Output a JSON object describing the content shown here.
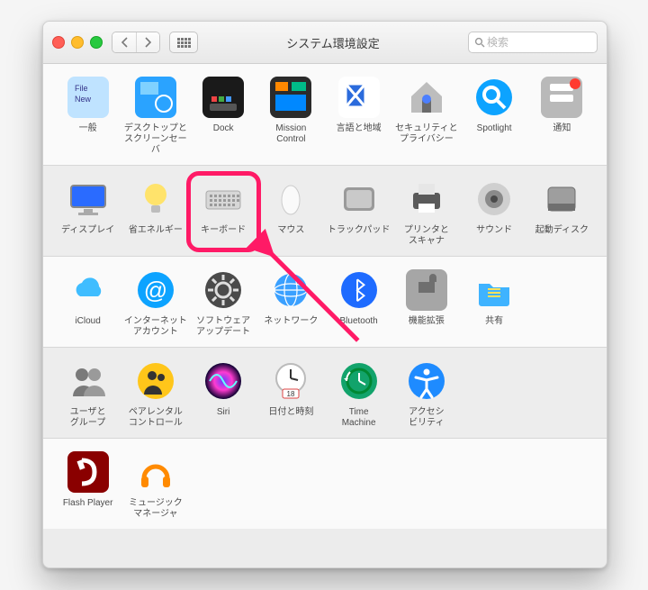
{
  "window_title": "システム環境設定",
  "search_placeholder": "検索",
  "rows": [
    {
      "items": [
        {
          "id": "general",
          "label": "一般",
          "kind": "general"
        },
        {
          "id": "desktop",
          "label": "デスクトップと\nスクリーンセーバ",
          "kind": "desktop"
        },
        {
          "id": "dock",
          "label": "Dock",
          "kind": "dock"
        },
        {
          "id": "mission",
          "label": "Mission\nControl",
          "kind": "mission"
        },
        {
          "id": "lang",
          "label": "言語と地域",
          "kind": "flag"
        },
        {
          "id": "security",
          "label": "セキュリティと\nプライバシー",
          "kind": "house"
        },
        {
          "id": "spotlight",
          "label": "Spotlight",
          "kind": "spotlight"
        },
        {
          "id": "notify",
          "label": "通知",
          "kind": "notify"
        }
      ]
    },
    {
      "items": [
        {
          "id": "display",
          "label": "ディスプレイ",
          "kind": "display"
        },
        {
          "id": "energy",
          "label": "省エネルギー",
          "kind": "bulb"
        },
        {
          "id": "keyboard",
          "label": "キーボード",
          "kind": "keyboard"
        },
        {
          "id": "mouse",
          "label": "マウス",
          "kind": "mouse"
        },
        {
          "id": "trackpad",
          "label": "トラックパッド",
          "kind": "trackpad"
        },
        {
          "id": "printer",
          "label": "プリンタと\nスキャナ",
          "kind": "printer"
        },
        {
          "id": "sound",
          "label": "サウンド",
          "kind": "sound"
        },
        {
          "id": "startup",
          "label": "起動ディスク",
          "kind": "disk"
        }
      ]
    },
    {
      "items": [
        {
          "id": "icloud",
          "label": "iCloud",
          "kind": "icloud"
        },
        {
          "id": "accounts",
          "label": "インターネット\nアカウント",
          "kind": "at"
        },
        {
          "id": "swupdate",
          "label": "ソフトウェア\nアップデート",
          "kind": "gear"
        },
        {
          "id": "network",
          "label": "ネットワーク",
          "kind": "network"
        },
        {
          "id": "bluetooth",
          "label": "Bluetooth",
          "kind": "bt"
        },
        {
          "id": "ext",
          "label": "機能拡張",
          "kind": "ext"
        },
        {
          "id": "share",
          "label": "共有",
          "kind": "folder"
        }
      ]
    },
    {
      "items": [
        {
          "id": "users",
          "label": "ユーザと\nグループ",
          "kind": "users"
        },
        {
          "id": "parental",
          "label": "ペアレンタル\nコントロール",
          "kind": "parental"
        },
        {
          "id": "siri",
          "label": "Siri",
          "kind": "siri"
        },
        {
          "id": "date",
          "label": "日付と時刻",
          "kind": "clock"
        },
        {
          "id": "tm",
          "label": "Time\nMachine",
          "kind": "tm"
        },
        {
          "id": "a11y",
          "label": "アクセシ\nビリティ",
          "kind": "a11y"
        }
      ]
    },
    {
      "items": [
        {
          "id": "flash",
          "label": "Flash Player",
          "kind": "flash"
        },
        {
          "id": "music",
          "label": "ミュージック\nマネージャ",
          "kind": "music"
        }
      ]
    }
  ],
  "highlight_target": "keyboard",
  "annotation_color": "#ff1a66"
}
